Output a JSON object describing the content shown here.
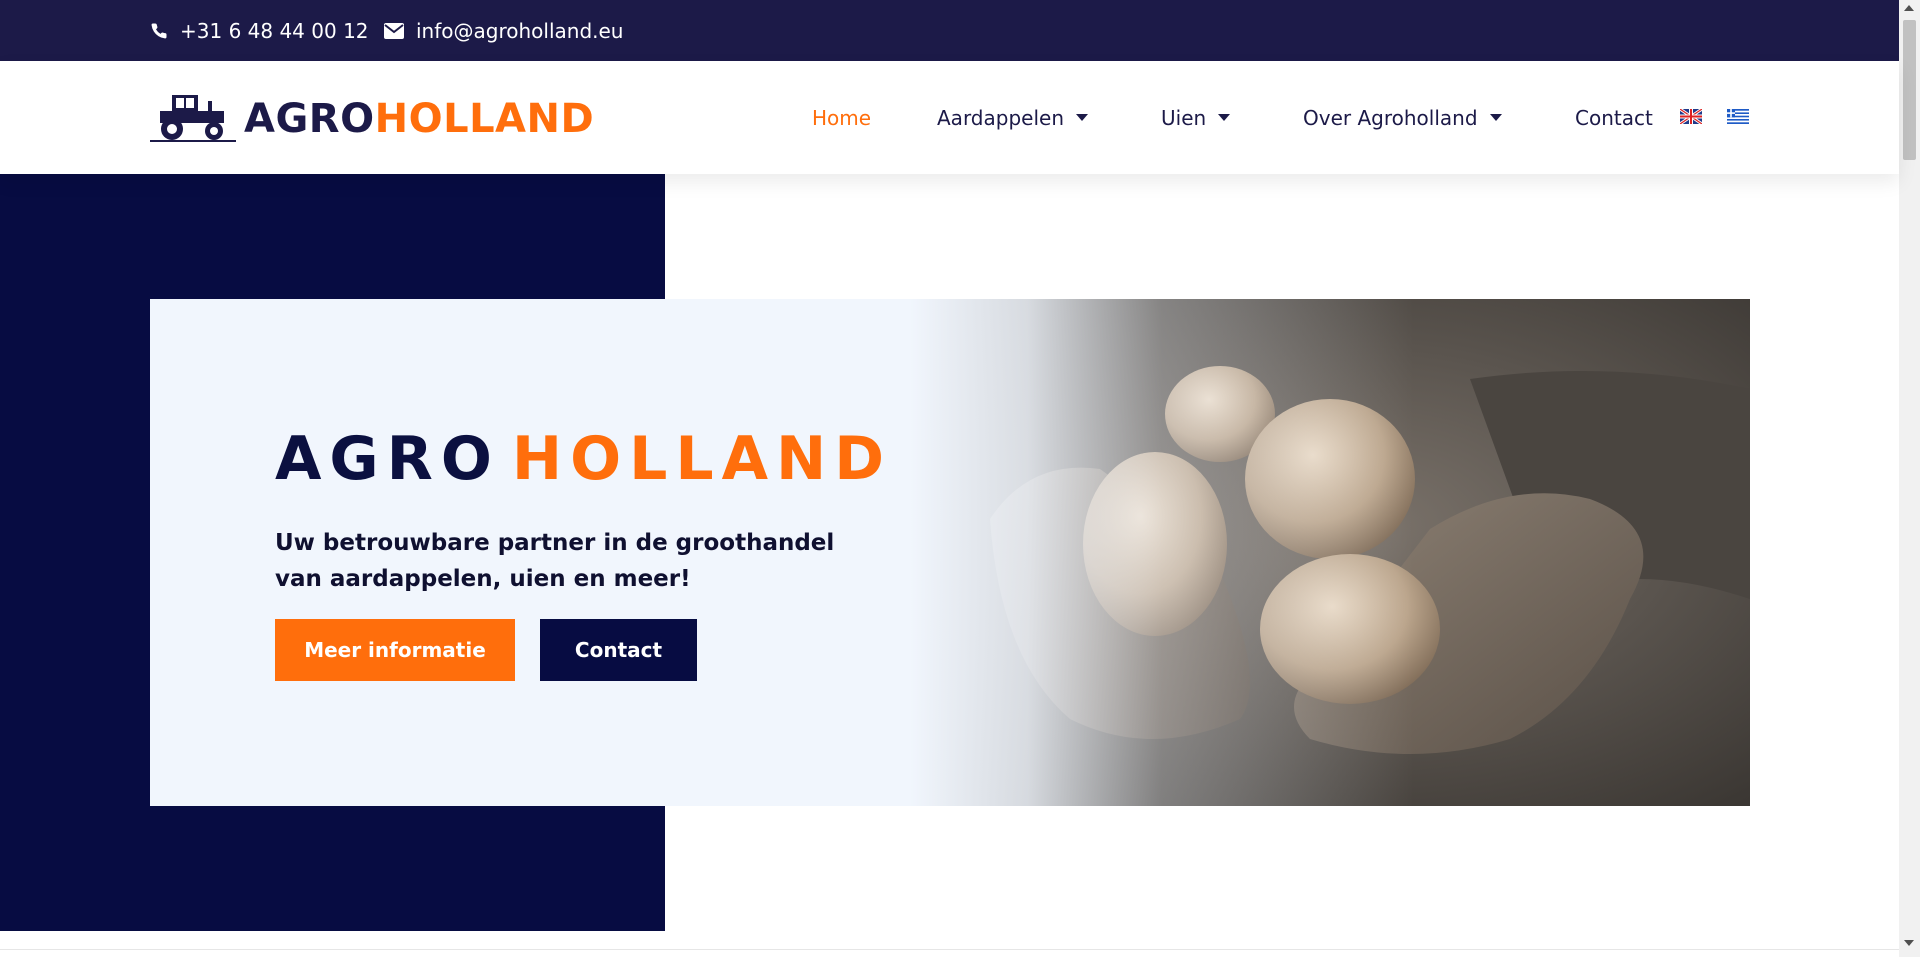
{
  "topbar": {
    "phone": "+31 6 48 44 00 12",
    "email": "info@agroholland.eu",
    "phone_icon": "phone-icon",
    "email_icon": "envelope-icon"
  },
  "header": {
    "logo_part1": "AGRO",
    "logo_part2": "HOLLAND",
    "logo_icon": "tractor-icon",
    "nav": [
      {
        "label": "Home",
        "active": true
      },
      {
        "label": "Aardappelen",
        "dropdown": true
      },
      {
        "label": "Uien",
        "dropdown": true
      },
      {
        "label": "Over Agroholland",
        "dropdown": true
      },
      {
        "label": "Contact"
      }
    ],
    "languages": [
      {
        "icon": "uk-flag-icon"
      },
      {
        "icon": "greece-flag-icon"
      }
    ]
  },
  "hero": {
    "title_part1": "AGRO",
    "title_part2": "HOLLAND",
    "subtitle": "Uw betrouwbare partner in de groothandel van aardappelen, uien en meer!",
    "primary_button": "Meer informatie",
    "secondary_button": "Contact"
  },
  "colors": {
    "navy": "#1c1a48",
    "dark_navy": "#070c42",
    "orange": "#ff6e0c",
    "hero_bg": "#f1f6fd"
  }
}
